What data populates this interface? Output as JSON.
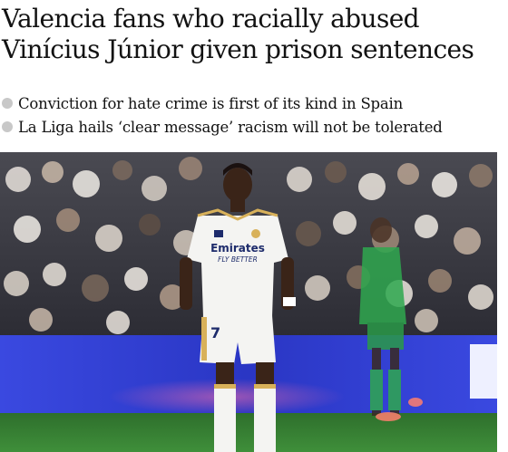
{
  "article": {
    "headline_lines": [
      "Valencia fans who racially abused",
      "Vinícius Júnior given prison sentences"
    ],
    "standfirst": [
      "Conviction for hate crime is first of its kind in Spain",
      "La Liga hails ‘clear message’ racism will not be tolerated"
    ]
  },
  "photo": {
    "shirt_sponsor_line1": "Emirates",
    "shirt_sponsor_line2": "FLY BETTER",
    "shirt_number": "7",
    "colors": {
      "pitch": "#2f7a2e",
      "ad_board": "#2d3bd0",
      "home_kit": "#f4f4f2",
      "away_kit": "#2fa84f",
      "crowd": "#3a3a44"
    }
  }
}
